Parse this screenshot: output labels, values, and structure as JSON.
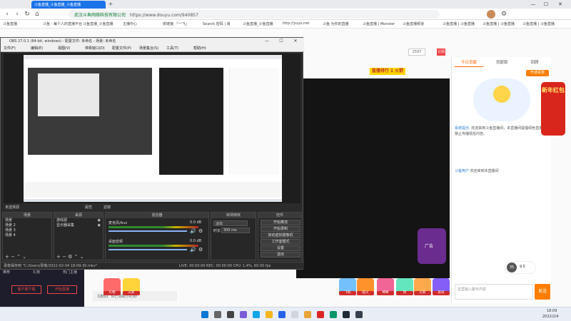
{
  "browser": {
    "tab_title": "斗鱼直播_斗鱼直播_斗鱼直播",
    "new_tab": "+",
    "window_controls": [
      "—",
      "☐",
      "✕"
    ],
    "url_secure_label": "武汉斗鱼网络科技有限公司",
    "url": "https://www.douyu.com/940857",
    "bookmarks": [
      "斗鱼直播",
      "斗鱼 - 每个人的直播平台",
      "斗鱼直播_斗鱼直播",
      "主播中心",
      "拼链接 「一飞」",
      "Search 密码 | 易",
      "斗鱼直播_斗鱼直播",
      "http://yuyu.net",
      "斗鱼·为你的直播",
      "斗鱼直播 | Monster",
      "斗鱼直播频道",
      "斗鱼直播 | 斗鱼直播",
      "斗鱼直播 | 斗鱼直播",
      "斗鱼直播 | 斗鱼直播"
    ]
  },
  "page": {
    "banner": "直播排行 1 火箭",
    "count": "2597",
    "live_btn": "订阅",
    "right_tabs": [
      "今日贡献",
      "贡献周",
      "回顾"
    ],
    "follow_btn": "开通贵族",
    "chat": [
      {
        "name": "系统提示:",
        "text": "欢迎来到斗鱼直播间，本直播间提倡绿色直播，禁止传播低俗内容。"
      },
      {
        "name": "斗鱼用户",
        "text": "欢迎来到本直播间"
      }
    ],
    "side_promo": "新年红包",
    "input_placeholder": "这里输入聊天内容",
    "send_label": "发送",
    "avatar_badge": "35",
    "follow_count": "9.5"
  },
  "obs": {
    "title": "OBS 27.0.1 (64-bit, windows) - 配置文件: 未命名 - 场景: 未命名",
    "menu": [
      "文件(F)",
      "编辑(E)",
      "视图(V)",
      "停靠窗口(D)",
      "配置文件(P)",
      "场景集合(S)",
      "工具(T)",
      "帮助(H)"
    ],
    "no_source": "未选择源",
    "props_btn": "属性",
    "filter_btn": "滤镜",
    "docks": {
      "scenes": "场景",
      "sources": "来源",
      "mixer": "混音器",
      "transitions": "转场特效",
      "controls": "控件"
    },
    "scenes": [
      "场景",
      "场景 2",
      "场景 3",
      "场景 4"
    ],
    "sources": [
      "游戏源",
      "显示器采集"
    ],
    "mixer": [
      {
        "name": "麦克风/Aux",
        "db": "0.0 dB"
      },
      {
        "name": "桌面音频",
        "db": "0.0 dB"
      }
    ],
    "transition_type": "淡出",
    "duration_label": "时长",
    "duration_value": "300 ms",
    "controls": [
      "开始推流",
      "开始录制",
      "启动虚拟摄像机",
      "工作室模式",
      "设置",
      "退出"
    ],
    "status": "LIVE: 00:00:00   REC: 00:00:00   CPU: 1.4%, 60.00 fps",
    "saved_replay": "录像保存到 \"C:/Users/录像/2022-02-04 18-09-30.mkv\""
  },
  "below": {
    "tabs": [
      "推荐",
      "礼物",
      "热门主播"
    ],
    "btn_left": "客户端下载",
    "btn_right": "开始直播",
    "gift_labels": [
      "礼物",
      "火箭",
      "飞机",
      "超火",
      "棒棒",
      "赞",
      "火箭",
      "航母"
    ],
    "notice": "【通知】 你已领取小礼物!"
  },
  "taskbar": {
    "time": "18:09",
    "date": "2022/2/4"
  },
  "colors": {
    "brand_orange": "#ff7e00",
    "tab_blue": "#1a73e8",
    "obs_dark": "#2b2b2b",
    "stage_dark": "#141414"
  }
}
